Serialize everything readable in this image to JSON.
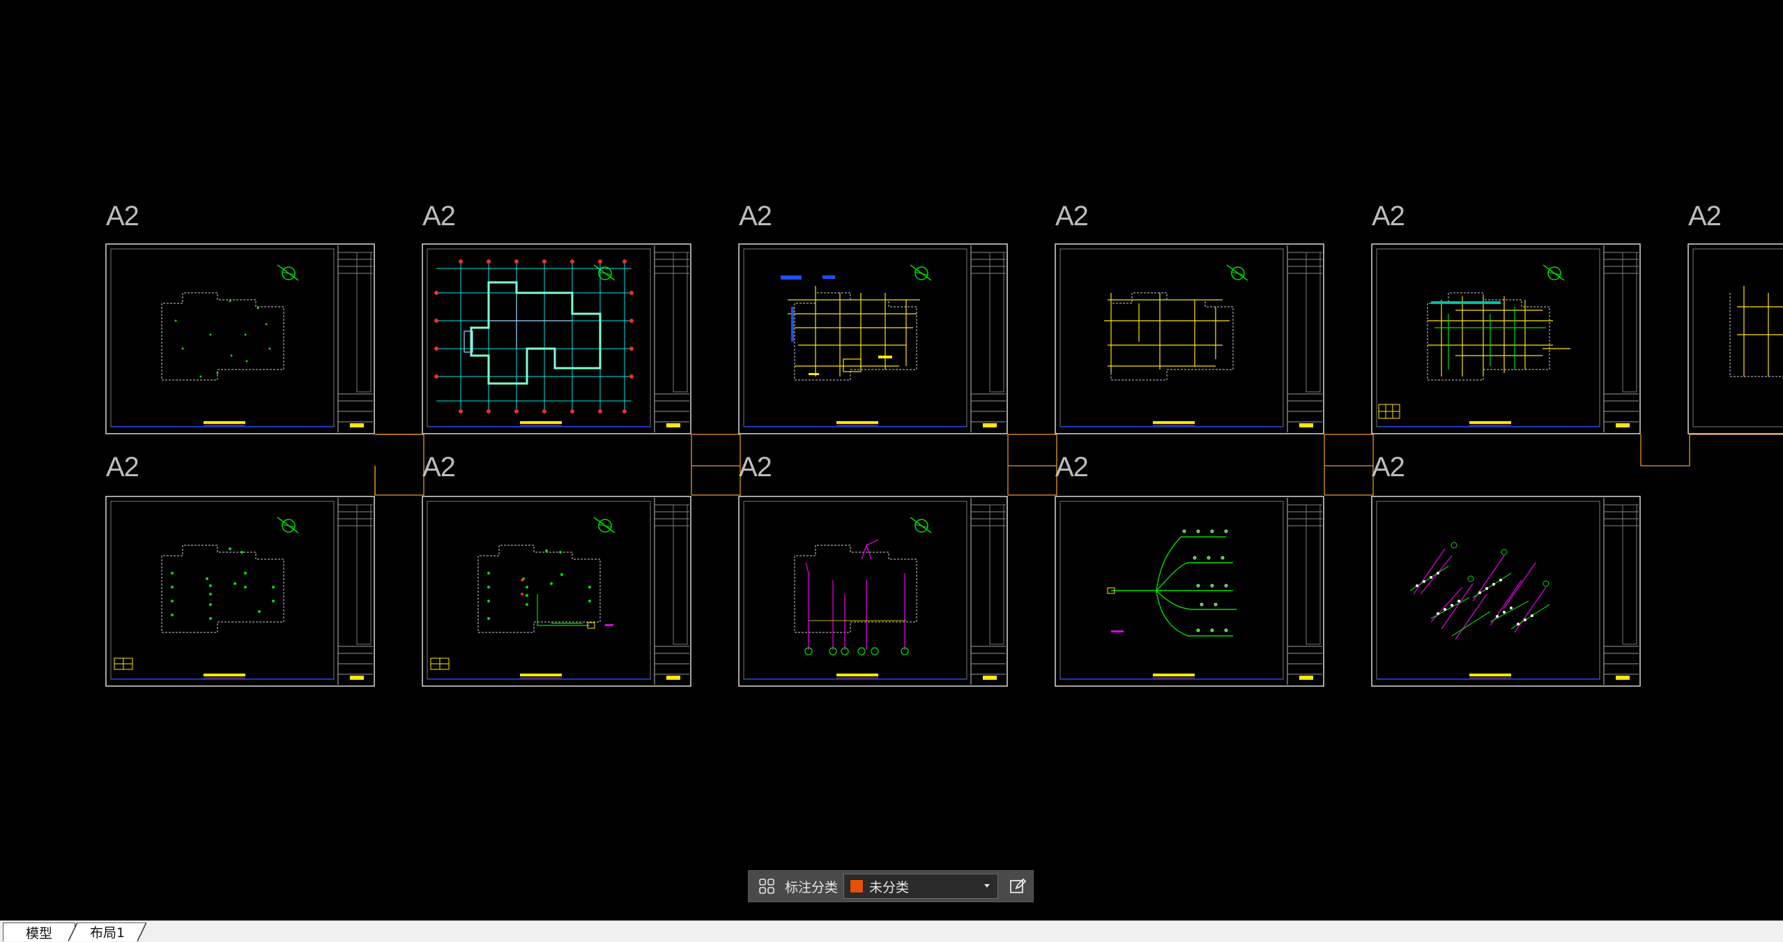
{
  "app": {
    "view": "model-space drawing canvas"
  },
  "colors": {
    "background": "#000000",
    "sheet_border": "#d9d9d9",
    "dashed_outline": "#cfcfcf",
    "yellow": "#ffe600",
    "green": "#00e000",
    "cyan": "#00e5e5",
    "magenta": "#e000e0",
    "red": "#ff2a2a",
    "blue": "#1e4fff",
    "orange_link": "#c8821a",
    "teal": "#00c0a0",
    "category_swatch": "#e8500a"
  },
  "sheets": {
    "row1": [
      {
        "size": "A2",
        "content": "grid-dots-plan"
      },
      {
        "size": "A2",
        "content": "structural-axis-plan"
      },
      {
        "size": "A2",
        "content": "yellow-wiring-plan"
      },
      {
        "size": "A2",
        "content": "yellow-tree-plan"
      },
      {
        "size": "A2",
        "content": "mixed-plan"
      },
      {
        "size": "A2",
        "content": "partial-sheet"
      }
    ],
    "row2": [
      {
        "size": "A2",
        "content": "dots-plan-legend"
      },
      {
        "size": "A2",
        "content": "dots-plan-circuit"
      },
      {
        "size": "A2",
        "content": "magenta-riser"
      },
      {
        "size": "A2",
        "content": "green-branch-tree"
      },
      {
        "size": "A2",
        "content": "isometric-diagram"
      }
    ]
  },
  "annotation_toolbar": {
    "icon": "grid-icon",
    "label": "标注分类",
    "selected_category": "未分类",
    "edit_icon": "edit-icon"
  },
  "tabs": [
    {
      "label": "模型",
      "active": false
    },
    {
      "label": "布局1",
      "active": true
    }
  ]
}
